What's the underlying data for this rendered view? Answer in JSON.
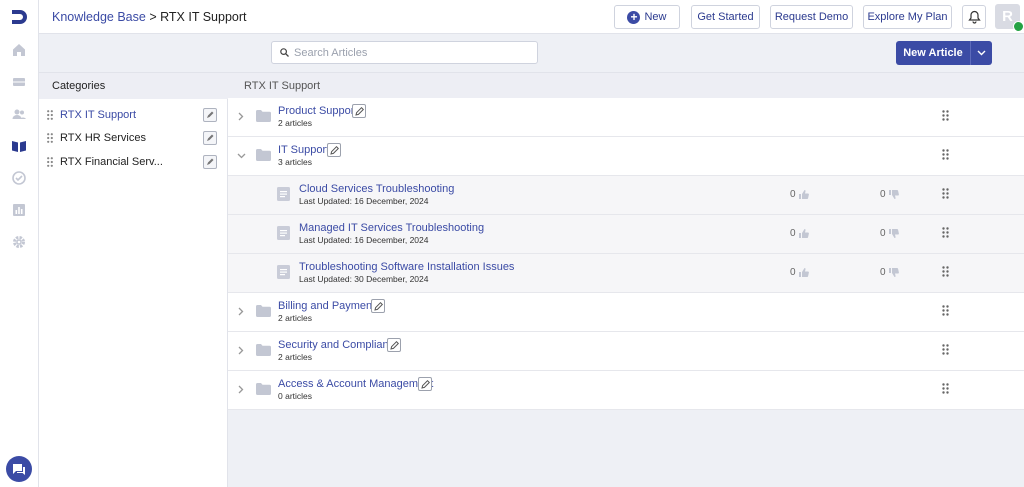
{
  "app": {
    "logo_icon": "brand-logo-icon",
    "accent": "#3b4ba5"
  },
  "breadcrumb": {
    "root": "Knowledge Base",
    "separator": ">",
    "current": "RTX IT Support"
  },
  "toolbar": {
    "new_label": "New",
    "get_started_label": "Get Started",
    "request_demo_label": "Request Demo",
    "explore_plan_label": "Explore My Plan",
    "avatar_initial": "R"
  },
  "search": {
    "placeholder": "Search Articles",
    "value": ""
  },
  "new_article_label": "New Article",
  "categories": {
    "heading": "Categories",
    "items": [
      {
        "label": "RTX IT Support",
        "active": true
      },
      {
        "label": "RTX HR Services",
        "active": false
      },
      {
        "label": "RTX Financial Serv...",
        "active": false
      }
    ]
  },
  "list": {
    "heading": "RTX IT Support",
    "rows": [
      {
        "type": "folder",
        "title": "Product Support",
        "subtitle": "2 articles",
        "expanded": false
      },
      {
        "type": "folder",
        "title": "IT Support",
        "subtitle": "3 articles",
        "expanded": true
      },
      {
        "type": "article",
        "title": "Cloud Services Troubleshooting",
        "subtitle": "Last Updated: 16 December, 2024",
        "likes": "0",
        "dislikes": "0"
      },
      {
        "type": "article",
        "title": "Managed IT Services Troubleshooting",
        "subtitle": "Last Updated: 16 December, 2024",
        "likes": "0",
        "dislikes": "0"
      },
      {
        "type": "article",
        "title": "Troubleshooting Software Installation Issues",
        "subtitle": "Last Updated: 30 December, 2024",
        "likes": "0",
        "dislikes": "0"
      },
      {
        "type": "folder",
        "title": "Billing and Payments",
        "subtitle": "2 articles",
        "expanded": false
      },
      {
        "type": "folder",
        "title": "Security and Compliance",
        "subtitle": "2 articles",
        "expanded": false
      },
      {
        "type": "folder",
        "title": "Access & Account Management",
        "subtitle": "0 articles",
        "expanded": false
      }
    ]
  }
}
